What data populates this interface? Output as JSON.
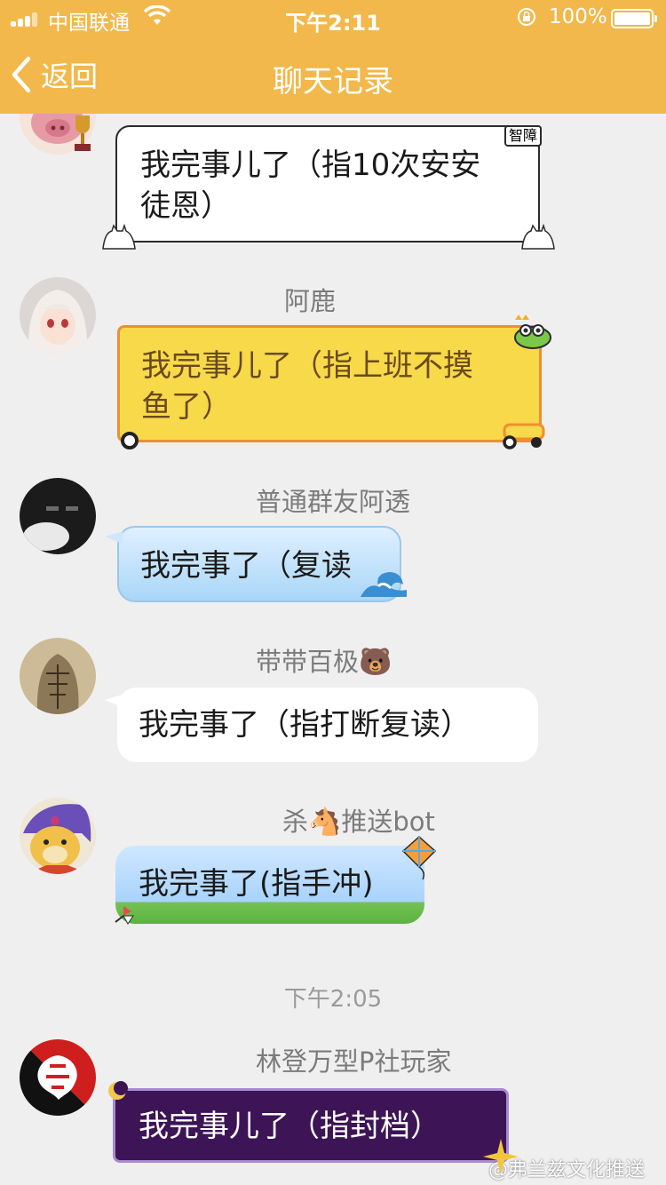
{
  "status_bar": {
    "carrier": "中国联通",
    "time": "下午2:11",
    "battery_percent": "100%",
    "battery_level": 1.0
  },
  "nav": {
    "back_label": "返回",
    "title": "聊天记录"
  },
  "messages": [
    {
      "sender": "",
      "text_line1": "我完事儿了（指10次安安",
      "text_line2": "徒恩）",
      "badge": "智障"
    },
    {
      "sender": "阿鹿",
      "text_line1": "我完事儿了（指上班不摸",
      "text_line2": "鱼了）"
    },
    {
      "sender": "普通群友阿透",
      "text": "我完事了（复读"
    },
    {
      "sender": "带带百极",
      "sender_emoji": "🐻",
      "text": "我完事了（指打断复读）"
    },
    {
      "sender_prefix": "杀",
      "sender_emoji": "🐴",
      "sender_suffix": "推送bot",
      "text": "我完事了(指手冲)"
    },
    {
      "sender": "林登万型P社玩家",
      "text": "我完事儿了（指封档）"
    }
  ],
  "timestamp": "下午2:05",
  "watermark": "@弗兰兹文化推送",
  "colors": {
    "header": "#f2b84b",
    "background": "#efefef",
    "yellow_bubble": "#f7d94a",
    "purple_bubble": "#3d1456"
  }
}
